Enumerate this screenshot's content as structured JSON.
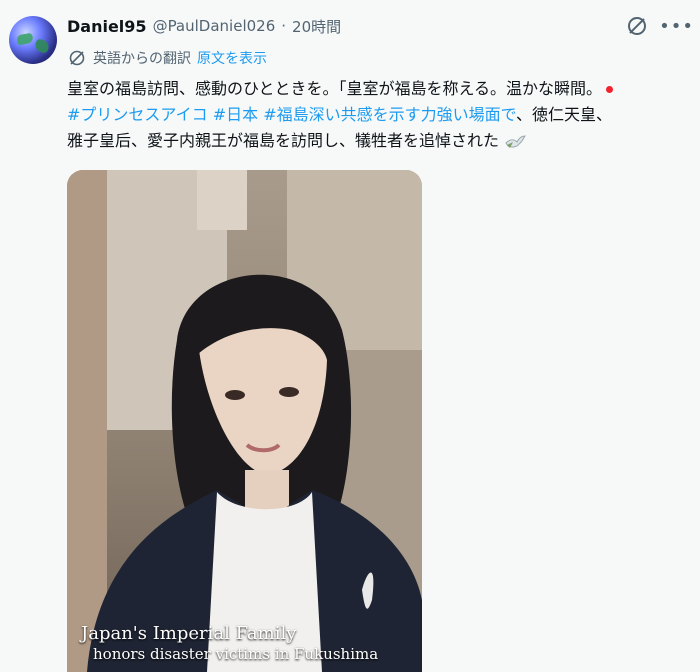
{
  "post": {
    "author_name": "Daniel95",
    "handle": "@PaulDaniel026",
    "separator": "·",
    "time": "20時間",
    "translation": {
      "from_label": "英語からの翻訳",
      "show_original": "原文を表示"
    },
    "text": {
      "line1": "皇室の福島訪問、感動のひとときを。「皇室が福島を称える。温かな瞬間。",
      "hashtags": [
        "#プリンセスアイコ",
        "#日本",
        "#福島深い共感を示す力強い場面で"
      ],
      "line2_tail": "、徳仁天皇、",
      "line3": "雅子皇后、愛子内親王が福島を訪問し、犠牲者を追悼された"
    },
    "video": {
      "caption_line1": "Japan's Imperial Family",
      "caption_line2": "honors disaster victims in Fukushima"
    }
  },
  "icons": {
    "avatar": "globe-avatar",
    "grok": "grok-icon",
    "more": "more-icon",
    "translate": "translate-icon",
    "dove": "dove-emoji"
  },
  "colors": {
    "link": "#1d9bf0",
    "secondary_text": "#536471",
    "text": "#0f1419",
    "background": "#f7f9f9",
    "red_dot": "#f4212e"
  }
}
